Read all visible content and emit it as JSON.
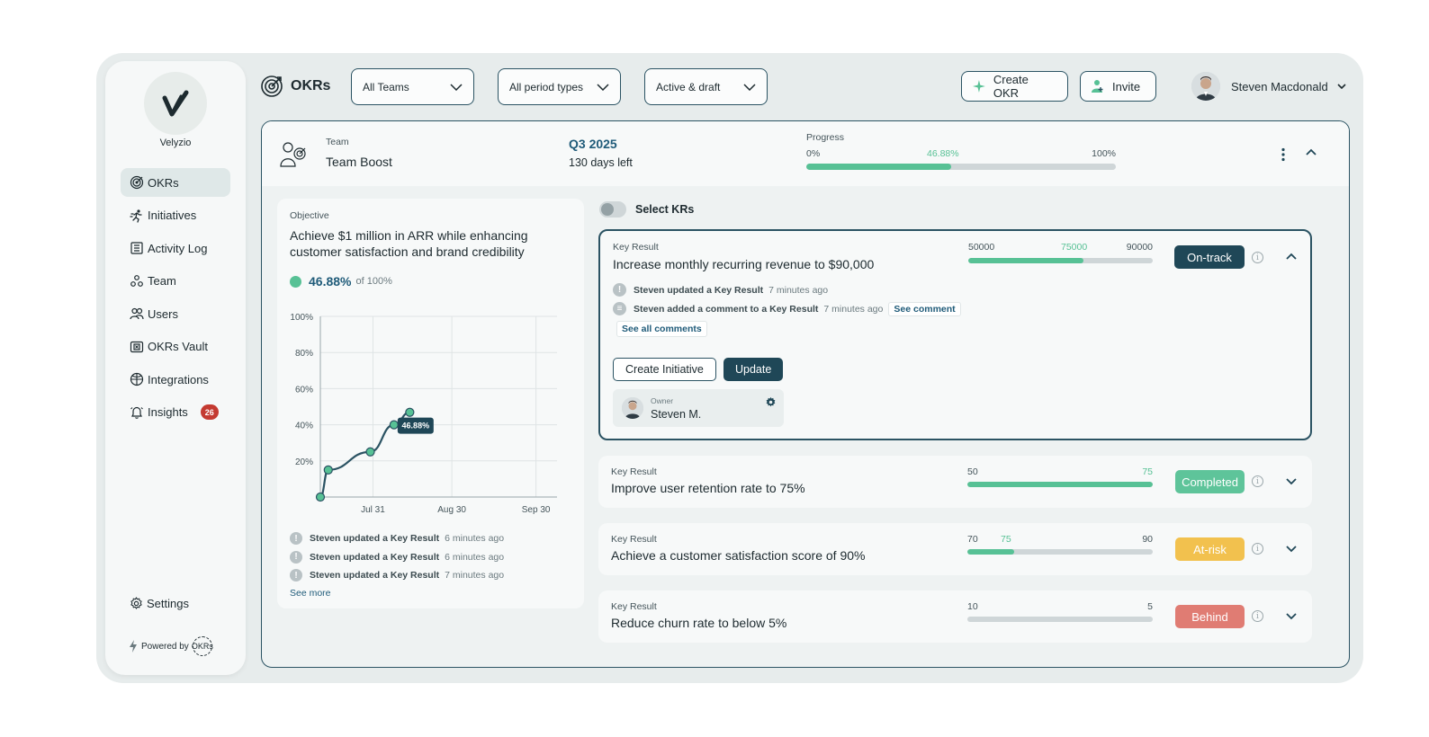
{
  "app": {
    "brand": "Velyzio",
    "page_title": "OKRs"
  },
  "sidebar": {
    "items": [
      {
        "label": "OKRs",
        "icon": "okrs-icon",
        "active": true
      },
      {
        "label": "Initiatives",
        "icon": "running-icon"
      },
      {
        "label": "Activity Log",
        "icon": "list-icon"
      },
      {
        "label": "Team",
        "icon": "team-icon"
      },
      {
        "label": "Users",
        "icon": "users-icon"
      },
      {
        "label": "OKRs Vault",
        "icon": "vault-icon"
      },
      {
        "label": "Integrations",
        "icon": "globe-icon"
      },
      {
        "label": "Insights",
        "icon": "bell-icon",
        "badge": "26"
      }
    ],
    "settings": "Settings",
    "powered_by": "Powered by",
    "powered_logo": "OKRs"
  },
  "filters": {
    "teams": "All Teams",
    "period": "All period types",
    "status": "Active & draft"
  },
  "actions": {
    "create_okr": "Create OKR",
    "invite": "Invite"
  },
  "user": {
    "name": "Steven Macdonald"
  },
  "team_header": {
    "team_label": "Team",
    "team_name": "Team Boost",
    "quarter": "Q3 2025",
    "days_left": "130 days left",
    "progress_label": "Progress",
    "progress_min": "0%",
    "progress_value": "46.88%",
    "progress_max": "100%",
    "progress_fraction": 0.4688
  },
  "objective": {
    "label": "Objective",
    "title": "Achieve $1 million in ARR while enhancing customer satisfaction and brand credibility",
    "progress": "46.88%",
    "of": "of 100%",
    "activity": [
      {
        "who": "Steven updated a Key Result",
        "when": "6 minutes ago"
      },
      {
        "who": "Steven updated a Key Result",
        "when": "6 minutes ago"
      },
      {
        "who": "Steven updated a Key Result",
        "when": "7 minutes ago"
      }
    ],
    "see_more": "See more"
  },
  "chart_data": {
    "type": "line",
    "y_ticks": [
      "100%",
      "80%",
      "60%",
      "40%",
      "20%"
    ],
    "x_ticks": [
      "Jul 31",
      "Aug 30",
      "Sep 30"
    ],
    "ylim": [
      0,
      100
    ],
    "points": [
      {
        "x": 0,
        "y": 0
      },
      {
        "x": 3,
        "y": 15
      },
      {
        "x": 19,
        "y": 25
      },
      {
        "x": 28,
        "y": 40
      },
      {
        "x": 34,
        "y": 46.88
      }
    ],
    "x_max": 90,
    "x_tick_positions": [
      20,
      50,
      82
    ],
    "tooltip": "46.88%",
    "color": "#2b5363",
    "point_color": "#57c195"
  },
  "select_krs": "Select KRs",
  "key_results": [
    {
      "label": "Key Result",
      "title": "Increase monthly recurring revenue to $90,000",
      "start": "50000",
      "current": "75000",
      "target": "90000",
      "fill_fraction": 0.625,
      "status": "On-track",
      "status_color": "#1f4757",
      "expanded": true,
      "activity": [
        {
          "who": "Steven updated a Key Result",
          "when": "7 minutes ago"
        },
        {
          "who": "Steven added a comment to a Key Result",
          "when": "7 minutes ago",
          "link": "See comment"
        }
      ],
      "see_all": "See all comments",
      "create_initiative": "Create Initiative",
      "update": "Update",
      "owner_label": "Owner",
      "owner_name": "Steven M."
    },
    {
      "label": "Key Result",
      "title": "Improve user retention rate to 75%",
      "start": "50",
      "current": "",
      "target": "75",
      "fill_fraction": 1.0,
      "status": "Completed",
      "status_color": "#5ec49a"
    },
    {
      "label": "Key Result",
      "title": "Achieve a customer satisfaction score of 90%",
      "start": "70",
      "current": "75",
      "target": "90",
      "fill_fraction": 0.25,
      "status": "At-risk",
      "status_color": "#f2c14e"
    },
    {
      "label": "Key Result",
      "title": "Reduce churn rate to below 5%",
      "start": "10",
      "current": "",
      "target": "5",
      "fill_fraction": 0,
      "status": "Behind",
      "status_color": "#e07c73"
    }
  ]
}
